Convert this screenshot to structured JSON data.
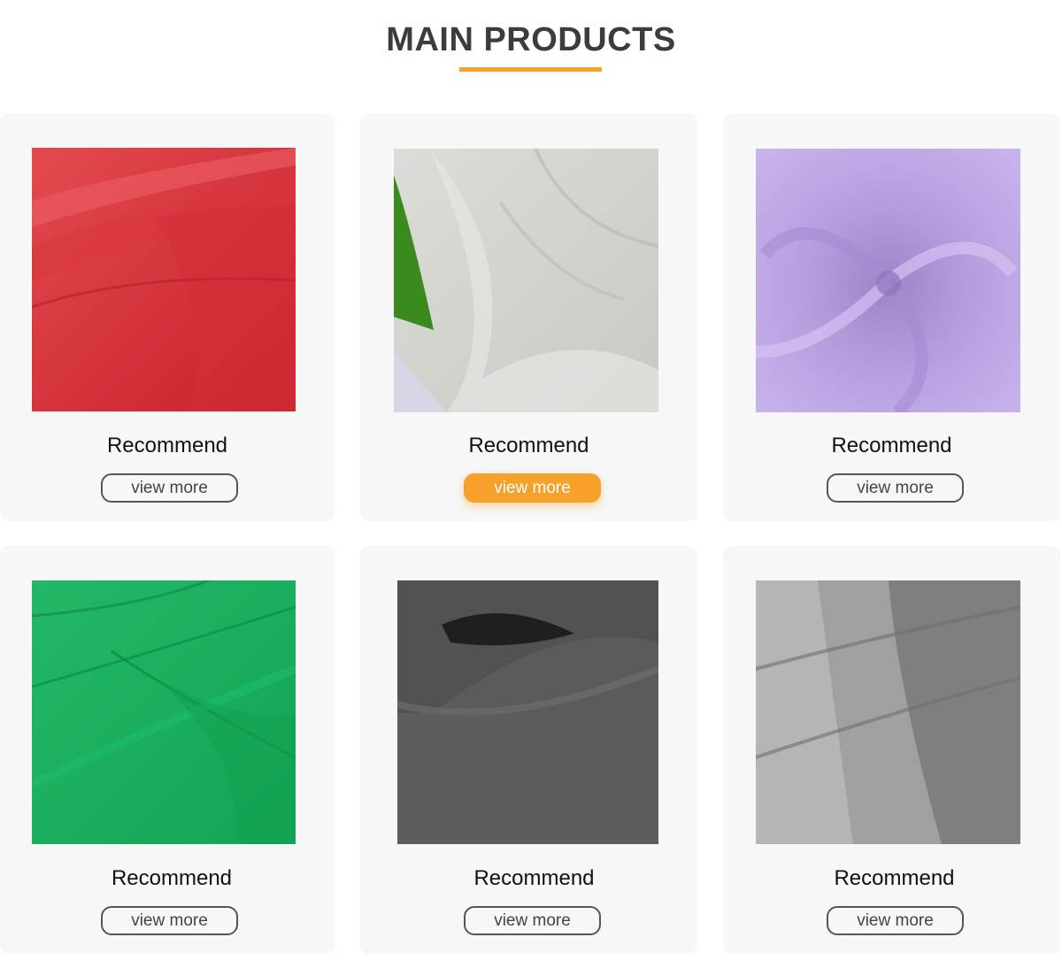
{
  "header": {
    "title": "MAIN PRODUCTS"
  },
  "colors": {
    "accent": "#f7a02b",
    "card_bg": "#f7f7f7",
    "title": "#3c3c3c"
  },
  "products": [
    {
      "title": "Recommend",
      "button": "view more",
      "active": false,
      "fabric": "red-fleece-fabric"
    },
    {
      "title": "Recommend",
      "button": "view more",
      "active": true,
      "fabric": "light-gray-heather-fabric"
    },
    {
      "title": "Recommend",
      "button": "view more",
      "active": false,
      "fabric": "lavender-pique-fabric"
    },
    {
      "title": "Recommend",
      "button": "view more",
      "active": false,
      "fabric": "green-jersey-fabric"
    },
    {
      "title": "Recommend",
      "button": "view more",
      "active": false,
      "fabric": "charcoal-heather-fabric"
    },
    {
      "title": "Recommend",
      "button": "view more",
      "active": false,
      "fabric": "gray-french-terry-fabric"
    }
  ]
}
